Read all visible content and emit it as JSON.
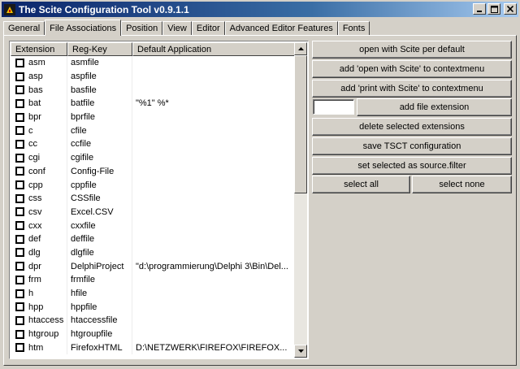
{
  "window": {
    "title": "The Scite Configuration Tool v0.9.1.1",
    "controls": {
      "minimize": "_",
      "maximize": "□",
      "close": "×"
    }
  },
  "tabs": [
    {
      "label": "General"
    },
    {
      "label": "File Associations"
    },
    {
      "label": "Position"
    },
    {
      "label": "View"
    },
    {
      "label": "Editor"
    },
    {
      "label": "Advanced Editor Features"
    },
    {
      "label": "Fonts"
    }
  ],
  "list": {
    "columns": [
      "Extension",
      "Reg-Key",
      "Default Application"
    ],
    "rows": [
      {
        "ext": "asm",
        "key": "asmfile",
        "app": ""
      },
      {
        "ext": "asp",
        "key": "aspfile",
        "app": ""
      },
      {
        "ext": "bas",
        "key": "basfile",
        "app": ""
      },
      {
        "ext": "bat",
        "key": "batfile",
        "app": "\"%1\" %*"
      },
      {
        "ext": "bpr",
        "key": "bprfile",
        "app": ""
      },
      {
        "ext": "c",
        "key": "cfile",
        "app": ""
      },
      {
        "ext": "cc",
        "key": "ccfile",
        "app": ""
      },
      {
        "ext": "cgi",
        "key": "cgifile",
        "app": ""
      },
      {
        "ext": "conf",
        "key": "Config-File",
        "app": ""
      },
      {
        "ext": "cpp",
        "key": "cppfile",
        "app": ""
      },
      {
        "ext": "css",
        "key": "CSSfile",
        "app": ""
      },
      {
        "ext": "csv",
        "key": "Excel.CSV",
        "app": ""
      },
      {
        "ext": "cxx",
        "key": "cxxfile",
        "app": ""
      },
      {
        "ext": "def",
        "key": "deffile",
        "app": ""
      },
      {
        "ext": "dlg",
        "key": "dlgfile",
        "app": ""
      },
      {
        "ext": "dpr",
        "key": "DelphiProject",
        "app": "\"d:\\programmierung\\Delphi 3\\Bin\\Del..."
      },
      {
        "ext": "frm",
        "key": "frmfile",
        "app": ""
      },
      {
        "ext": "h",
        "key": "hfile",
        "app": ""
      },
      {
        "ext": "hpp",
        "key": "hppfile",
        "app": ""
      },
      {
        "ext": "htaccess",
        "key": "htaccessfile",
        "app": ""
      },
      {
        "ext": "htgroup",
        "key": "htgroupfile",
        "app": ""
      },
      {
        "ext": "htm",
        "key": "FirefoxHTML",
        "app": "D:\\NETZWERK\\FIREFOX\\FIREFOX..."
      }
    ]
  },
  "actions": {
    "open_with_scite": "open with Scite per default",
    "add_open_context": "add 'open with Scite' to contextmenu",
    "add_print_context": "add 'print with Scite' to contextmenu",
    "add_extension": "add file extension",
    "extension_input_value": "",
    "delete_selected": "delete selected extensions",
    "save_config": "save TSCT configuration",
    "set_source_filter": "set selected as source.filter",
    "select_all": "select all",
    "select_none": "select none"
  }
}
